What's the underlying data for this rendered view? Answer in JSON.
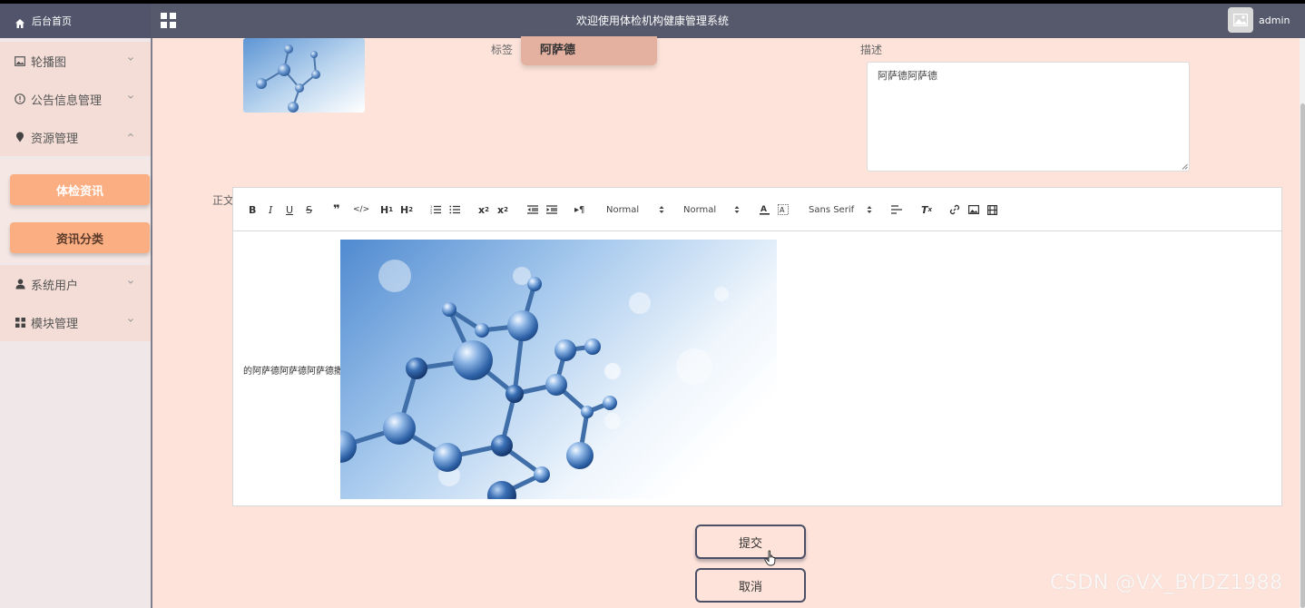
{
  "header": {
    "home_label": "后台首页",
    "app_title": "欢迎使用体检机构健康管理系统",
    "username": "admin"
  },
  "sidebar": {
    "items": [
      {
        "label": "轮播图",
        "icon": "picture-icon",
        "expanded": false
      },
      {
        "label": "公告信息管理",
        "icon": "info-icon",
        "expanded": false
      },
      {
        "label": "资源管理",
        "icon": "location-pin-icon",
        "expanded": true
      },
      {
        "label": "系统用户",
        "icon": "user-icon",
        "expanded": false
      },
      {
        "label": "模块管理",
        "icon": "grid-icon",
        "expanded": false
      }
    ],
    "subitems": [
      {
        "label": "体检资讯",
        "active": false
      },
      {
        "label": "资讯分类",
        "active": true
      }
    ]
  },
  "form": {
    "tag_label": "标签",
    "tag_value": "阿萨德",
    "desc_label": "描述",
    "desc_value": "阿萨德阿萨德",
    "body_label": "正文",
    "body_text": "的阿萨德阿萨德阿萨德撒",
    "submit_label": "提交",
    "cancel_label": "取消"
  },
  "editor_toolbar": {
    "header_select": "Normal",
    "size_select": "Normal",
    "font_select": "Sans Serif",
    "icons": [
      "bold-icon",
      "italic-icon",
      "underline-icon",
      "strike-icon",
      "blockquote-icon",
      "code-block-icon",
      "header1-icon",
      "header2-icon",
      "ordered-list-icon",
      "bullet-list-icon",
      "subscript-icon",
      "superscript-icon",
      "outdent-icon",
      "indent-icon",
      "text-direction-icon",
      "font-color-icon",
      "background-color-icon",
      "align-icon",
      "clean-format-icon",
      "link-icon",
      "image-icon",
      "video-icon"
    ]
  },
  "watermark": "CSDN @VX_BYDZ1988",
  "colors": {
    "topbar": "#56596b",
    "content_bg": "#fde3da",
    "sidebar_bg": "#f0e8e8",
    "sub_button": "#fbae82",
    "tag_field": "#e4b1a0"
  }
}
